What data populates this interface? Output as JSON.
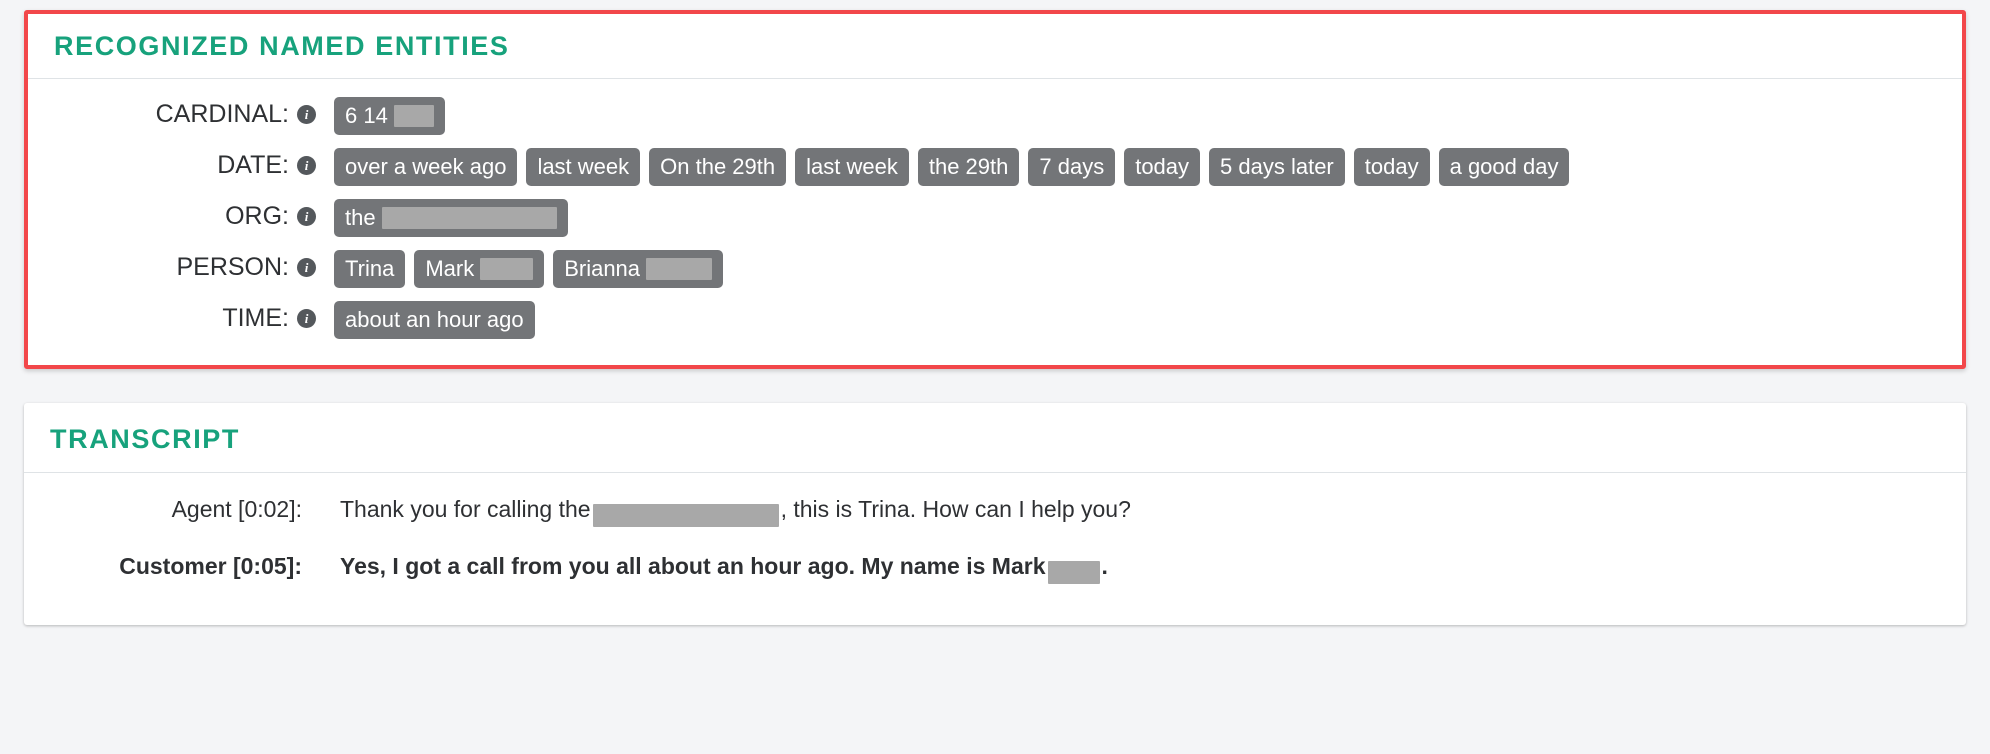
{
  "colors": {
    "accent_teal": "#17a27c",
    "highlight_border_red": "#f2474a",
    "chip_gray": "#737578",
    "redaction_gray": "#a8a8a8",
    "page_background": "#f4f5f7",
    "card_background": "#ffffff",
    "text": "#2e3033"
  },
  "entities_panel": {
    "title": "RECOGNIZED NAMED ENTITIES",
    "info_icon_glyph": "i",
    "rows": [
      {
        "label": "CARDINAL:",
        "icon": "info-icon",
        "chips": [
          {
            "text": "6 14",
            "redaction_width": 40
          }
        ]
      },
      {
        "label": "DATE:",
        "icon": "info-icon",
        "chips": [
          {
            "text": "over a week ago",
            "redaction_width": 0
          },
          {
            "text": "last week",
            "redaction_width": 0
          },
          {
            "text": "On the 29th",
            "redaction_width": 0
          },
          {
            "text": "last week",
            "redaction_width": 0
          },
          {
            "text": "the 29th",
            "redaction_width": 0
          },
          {
            "text": "7 days",
            "redaction_width": 0
          },
          {
            "text": "today",
            "redaction_width": 0
          },
          {
            "text": "5 days later",
            "redaction_width": 0
          },
          {
            "text": "today",
            "redaction_width": 0
          },
          {
            "text": "a good day",
            "redaction_width": 0
          }
        ]
      },
      {
        "label": "ORG:",
        "icon": "info-icon",
        "chips": [
          {
            "text": "the",
            "redaction_width": 175
          }
        ]
      },
      {
        "label": "PERSON:",
        "icon": "info-icon",
        "chips": [
          {
            "text": "Trina",
            "redaction_width": 0
          },
          {
            "text": "Mark",
            "redaction_width": 53
          },
          {
            "text": "Brianna",
            "redaction_width": 66
          }
        ]
      },
      {
        "label": "TIME:",
        "icon": "info-icon",
        "chips": [
          {
            "text": "about an hour ago",
            "redaction_width": 0
          }
        ]
      }
    ]
  },
  "transcript_panel": {
    "title": "TRANSCRIPT",
    "turns": [
      {
        "speaker": "Agent [0:02]:",
        "role": "agent",
        "text_before": "Thank you for calling the",
        "redaction_width": 186,
        "text_after": ", this is Trina. How can I help you?"
      },
      {
        "speaker": "Customer [0:05]:",
        "role": "customer",
        "text_before": "Yes, I got a call from you all about an hour ago. My name is Mark",
        "redaction_width": 52,
        "text_after": "."
      }
    ]
  }
}
